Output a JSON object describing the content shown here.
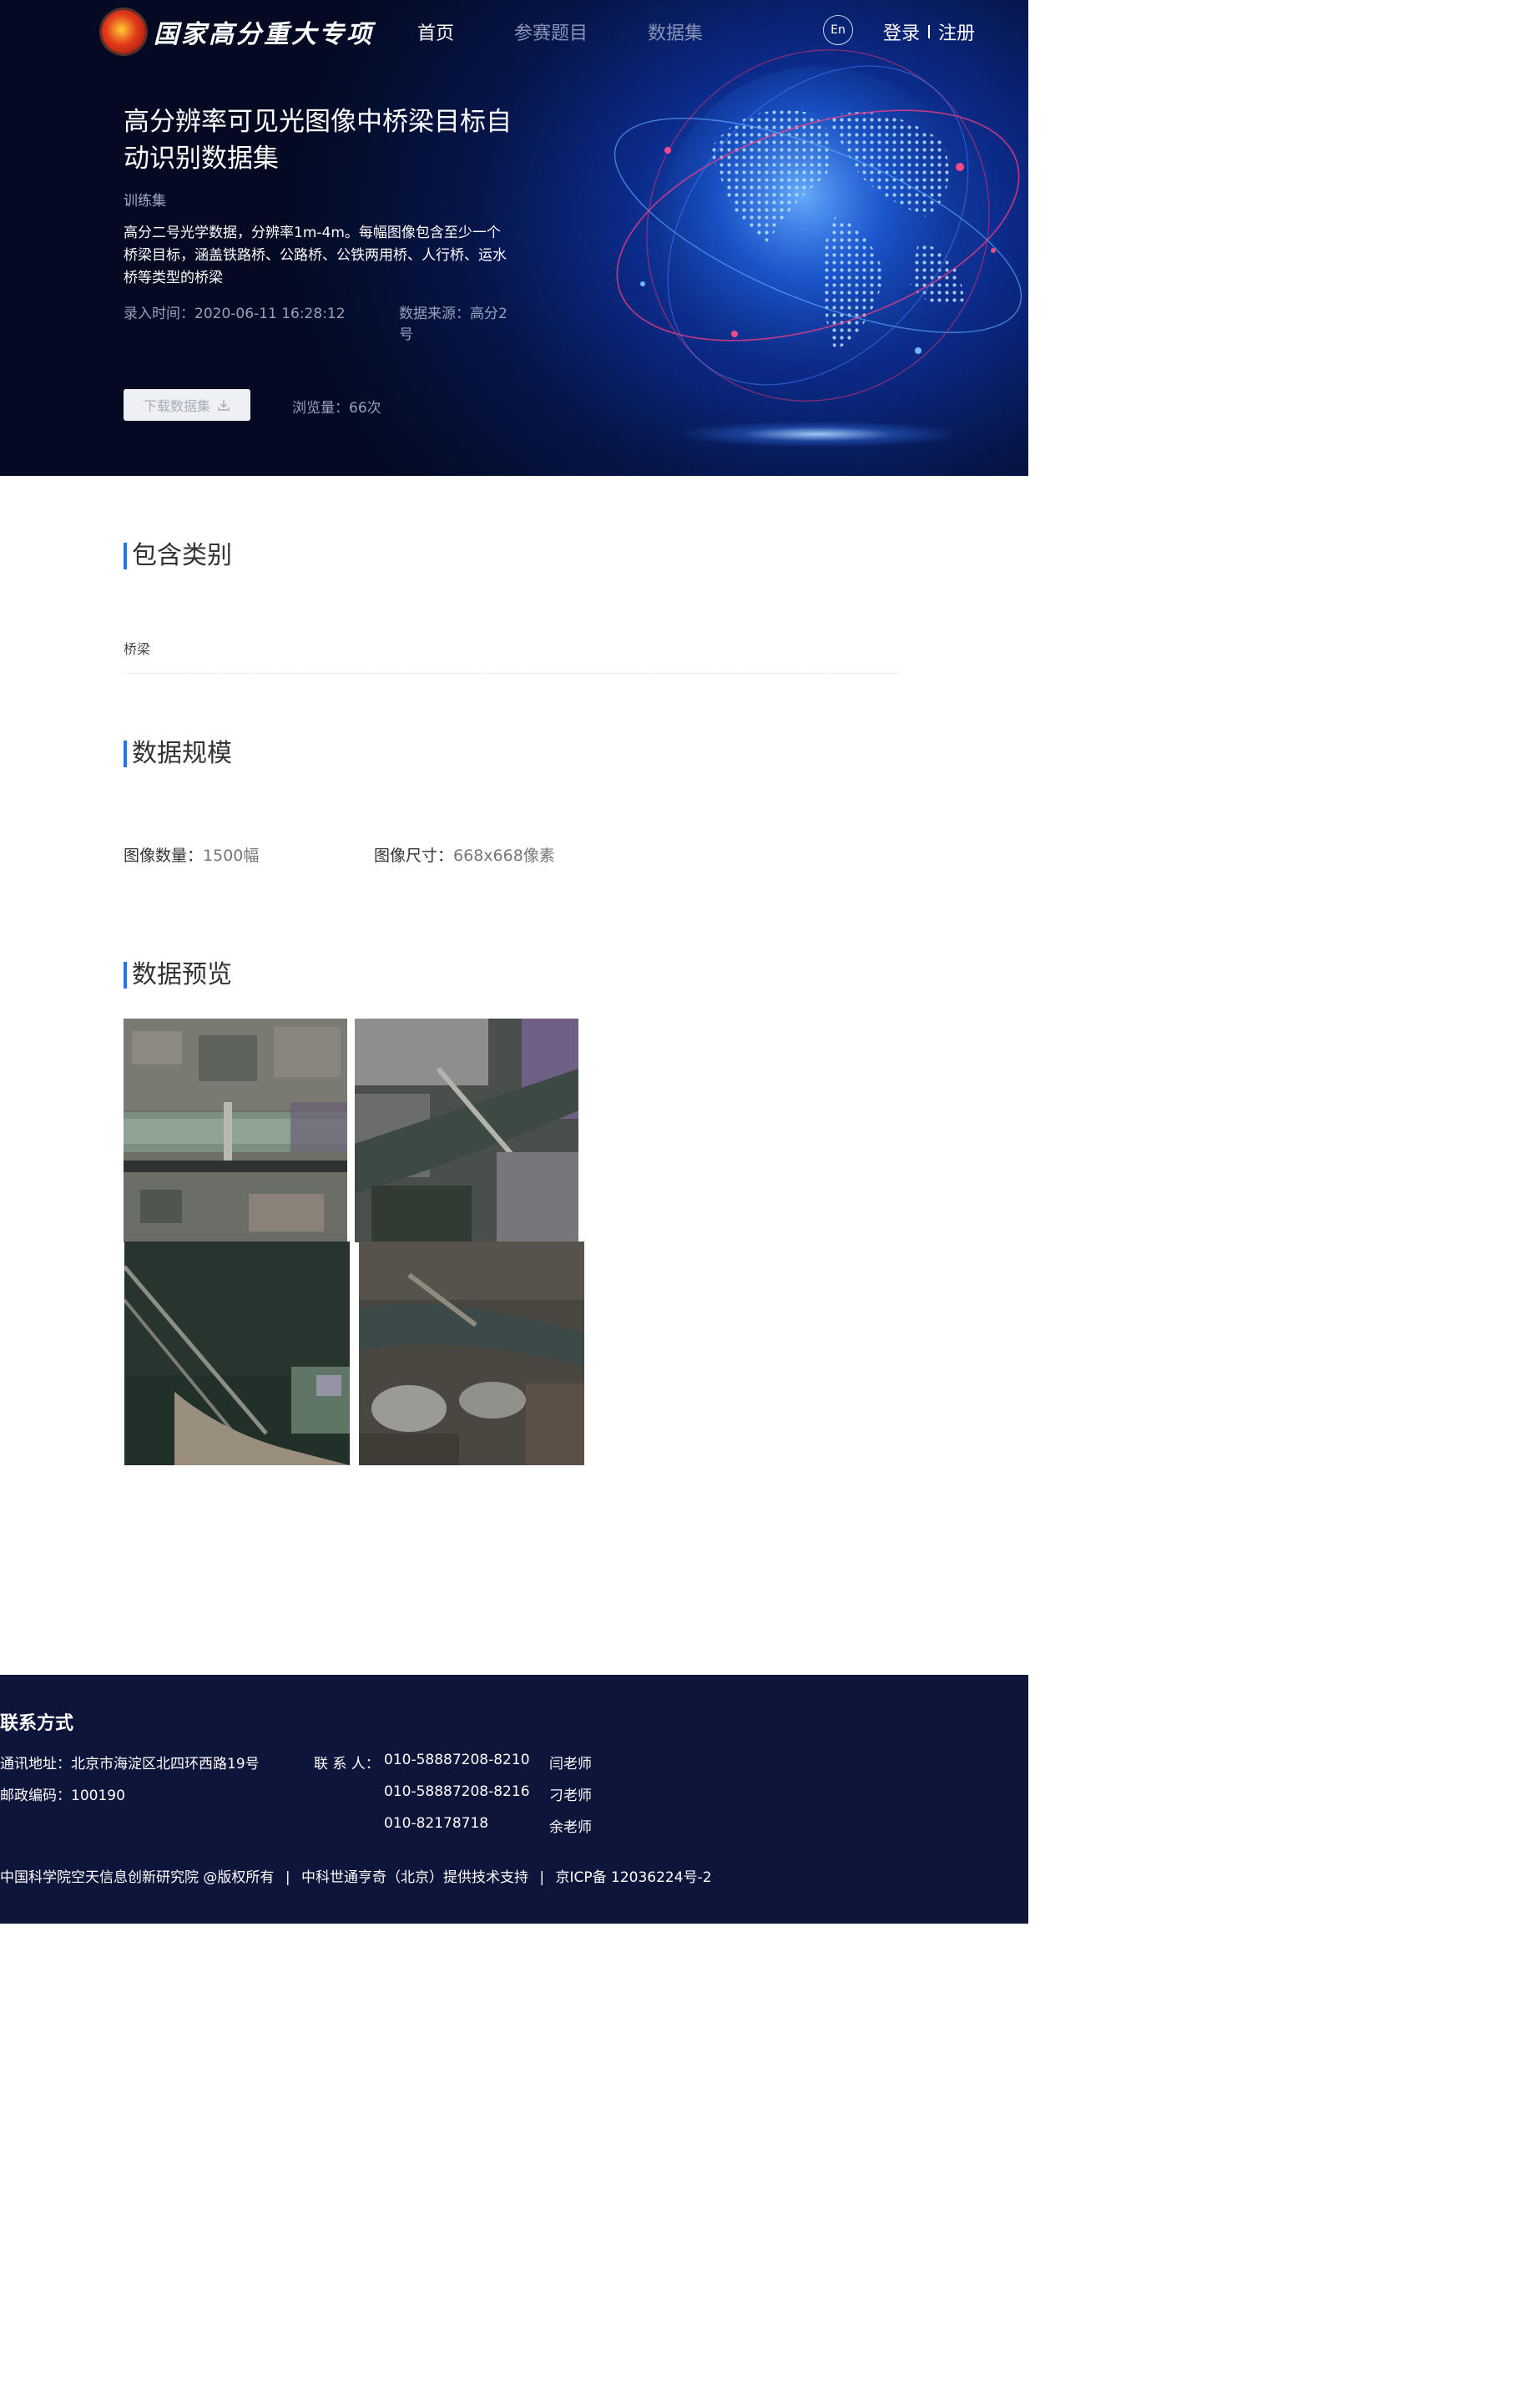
{
  "nav": {
    "logo_text": "国家高分重大专项",
    "home": "首页",
    "topics": "参赛题目",
    "datasets": "数据集",
    "lang": "En",
    "login": "登录",
    "register": "注册"
  },
  "hero": {
    "title": "高分辨率可见光图像中桥梁目标自动识别数据集",
    "tag": "训练集",
    "description": "高分二号光学数据，分辨率1m-4m。每幅图像包含至少一个桥梁目标，涵盖铁路桥、公路桥、公铁两用桥、人行桥、运水桥等类型的桥梁",
    "record_time": "录入时间：2020-06-11 16:28:12",
    "data_source": "数据来源：高分2号",
    "download_label": "下载数据集",
    "view_count": "浏览量：66次"
  },
  "sections": {
    "categories": {
      "title": "包含类别",
      "items": [
        "桥梁"
      ]
    },
    "scale": {
      "title": "数据规模",
      "image_count_label": "图像数量：",
      "image_count_value": "1500幅",
      "image_size_label": "图像尺寸：",
      "image_size_value": "668x668像素"
    },
    "preview": {
      "title": "数据预览",
      "images": [
        "satellite-bridge-1",
        "satellite-bridge-2",
        "satellite-bridge-3",
        "satellite-bridge-4"
      ]
    }
  },
  "footer": {
    "title": "联系方式",
    "address": "通讯地址：北京市海淀区北四环西路19号",
    "postcode": "邮政编码：100190",
    "contact_label": "联 系 人：",
    "contacts": [
      {
        "phone": "010-58887208-8210",
        "name": "闫老师"
      },
      {
        "phone": "010-58887208-8216",
        "name": "刁老师"
      },
      {
        "phone": "010-82178718",
        "name": "余老师"
      }
    ],
    "copyright": "中国科学院空天信息创新研究院 @版权所有",
    "support": "中科世通亨奇（北京）提供技术支持",
    "icp": "京ICP备 12036224号-2"
  },
  "colors": {
    "hero_bg": "#061548",
    "accent": "#2f6fe8",
    "footer_bg": "#0e153a"
  }
}
